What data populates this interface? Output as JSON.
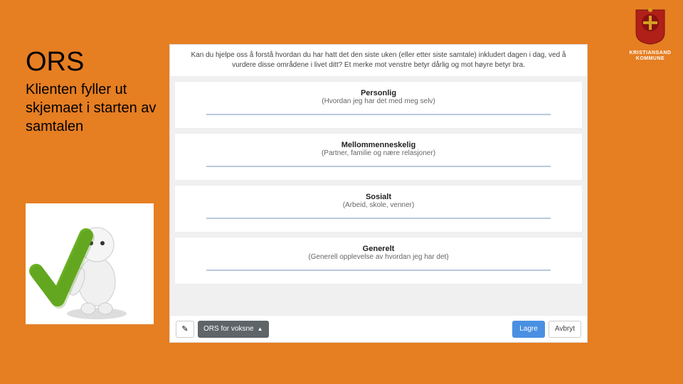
{
  "logo": {
    "line1": "KRISTIANSAND",
    "line2": "KOMMUNE"
  },
  "left": {
    "title": "ORS",
    "subtitle": "Klienten fyller ut skjemaet i starten av samtalen"
  },
  "form": {
    "instruction": "Kan du hjelpe oss å forstå hvordan du har hatt det den siste uken (eller etter siste samtale) inkludert dagen i dag, ved å vurdere disse områdene i livet ditt? Et merke mot venstre betyr dårlig og mot høyre betyr bra.",
    "sections": [
      {
        "title": "Personlig",
        "desc": "(Hvordan jeg har det med meg selv)"
      },
      {
        "title": "Mellommenneskelig",
        "desc": "(Partner, familie og nære relasjoner)"
      },
      {
        "title": "Sosialt",
        "desc": "(Arbeid, skole, venner)"
      },
      {
        "title": "Generelt",
        "desc": "(Generell opplevelse av hvordan jeg har det)"
      }
    ],
    "footer": {
      "dropdown_label": "ORS for voksne",
      "save_label": "Lagre",
      "cancel_label": "Avbryt"
    }
  }
}
